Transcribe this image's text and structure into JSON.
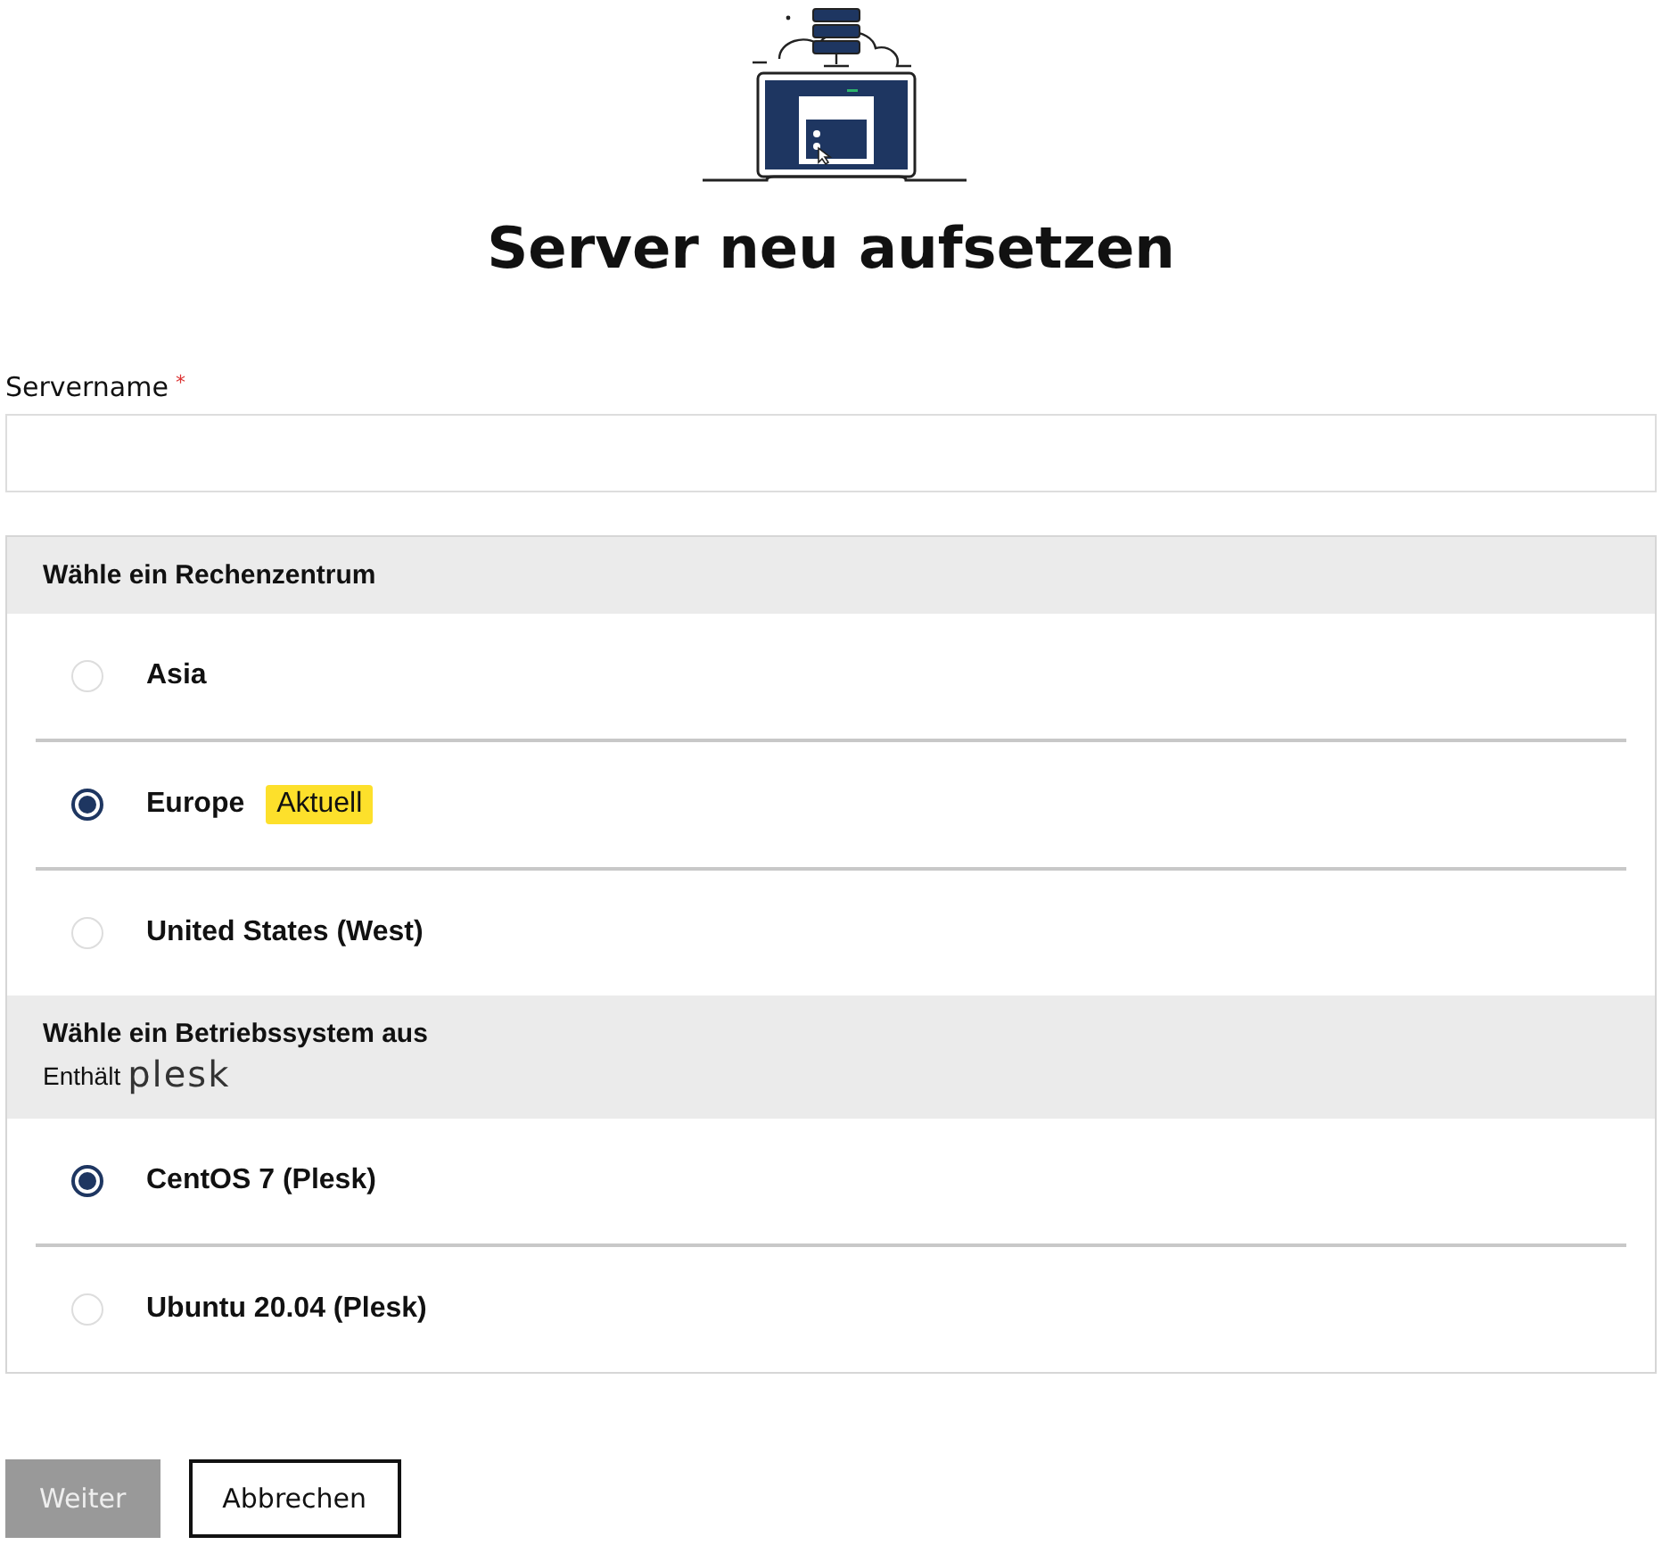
{
  "title": "Server neu aufsetzen",
  "server_name": {
    "label": "Servername",
    "required_mark": "*"
  },
  "sections": [
    {
      "heading": "Wähle ein Rechenzentrum",
      "options": [
        {
          "label": "Asia",
          "selected": false
        },
        {
          "label": "Europe",
          "selected": true,
          "badge": "Aktuell"
        },
        {
          "label": "United States (West)",
          "selected": false
        }
      ]
    },
    {
      "heading": "Wähle ein Betriebssystem aus",
      "note": "Enthält",
      "logo_text": "plesk",
      "options": [
        {
          "label": "CentOS 7 (Plesk)",
          "selected": true
        },
        {
          "label": "Ubuntu 20.04 (Plesk)",
          "selected": false
        }
      ]
    }
  ],
  "buttons": [
    {
      "label": "Weiter",
      "kind": "primary",
      "disabled": true
    },
    {
      "label": "Abbrechen",
      "kind": "secondary",
      "disabled": false
    }
  ]
}
